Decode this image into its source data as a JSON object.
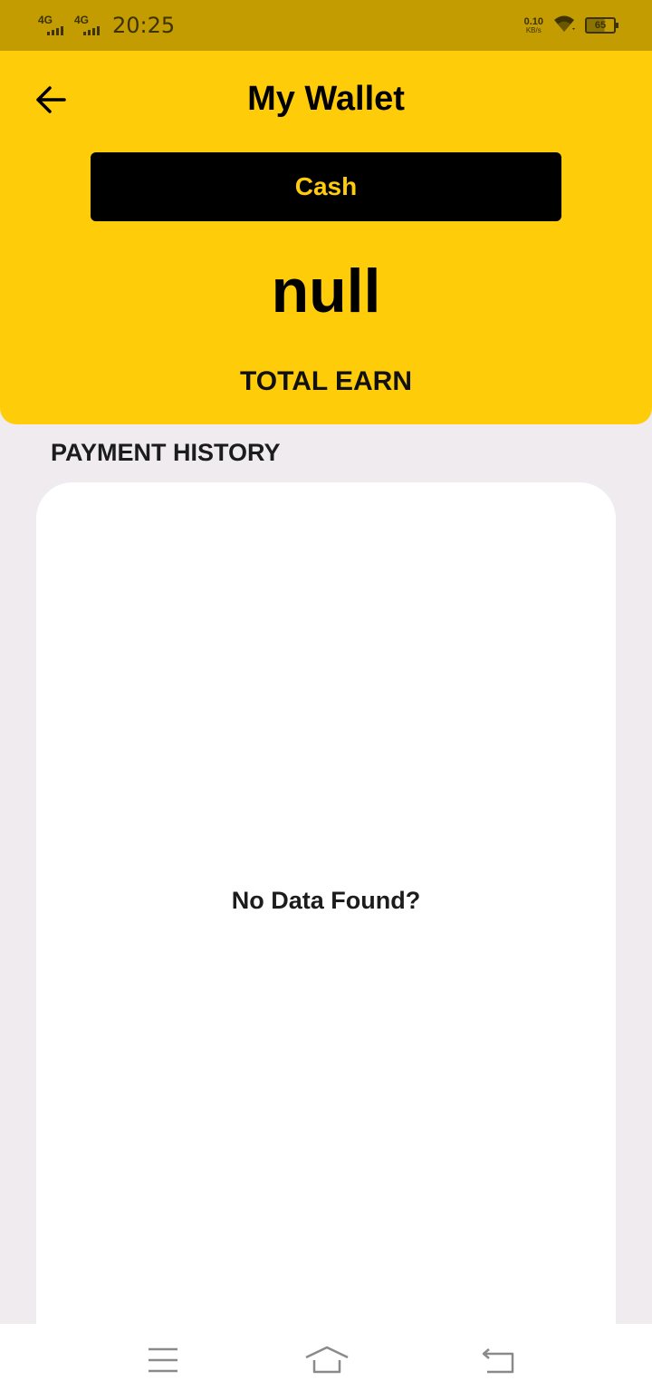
{
  "status_bar": {
    "network_1": "4G",
    "network_2": "4G",
    "time": "20:25",
    "speed_value": "0.10",
    "speed_unit": "KB/s",
    "battery": "65",
    "icons": [
      "signal-icon",
      "wifi-icon",
      "battery-icon"
    ]
  },
  "header": {
    "back_icon": "arrow-left-icon",
    "title": "My Wallet",
    "cash_button_label": "Cash",
    "amount": "null",
    "total_label": "TOTAL EARN"
  },
  "payment_history": {
    "title": "PAYMENT HISTORY",
    "empty_message": "No Data Found?"
  },
  "nav_bar": {
    "icons": [
      "menu-icon",
      "home-icon",
      "back-icon"
    ]
  },
  "colors": {
    "accent": "#ffcc0a",
    "status_bar": "#c29c00",
    "button": "#000000",
    "background": "#efebef",
    "card": "#ffffff"
  }
}
